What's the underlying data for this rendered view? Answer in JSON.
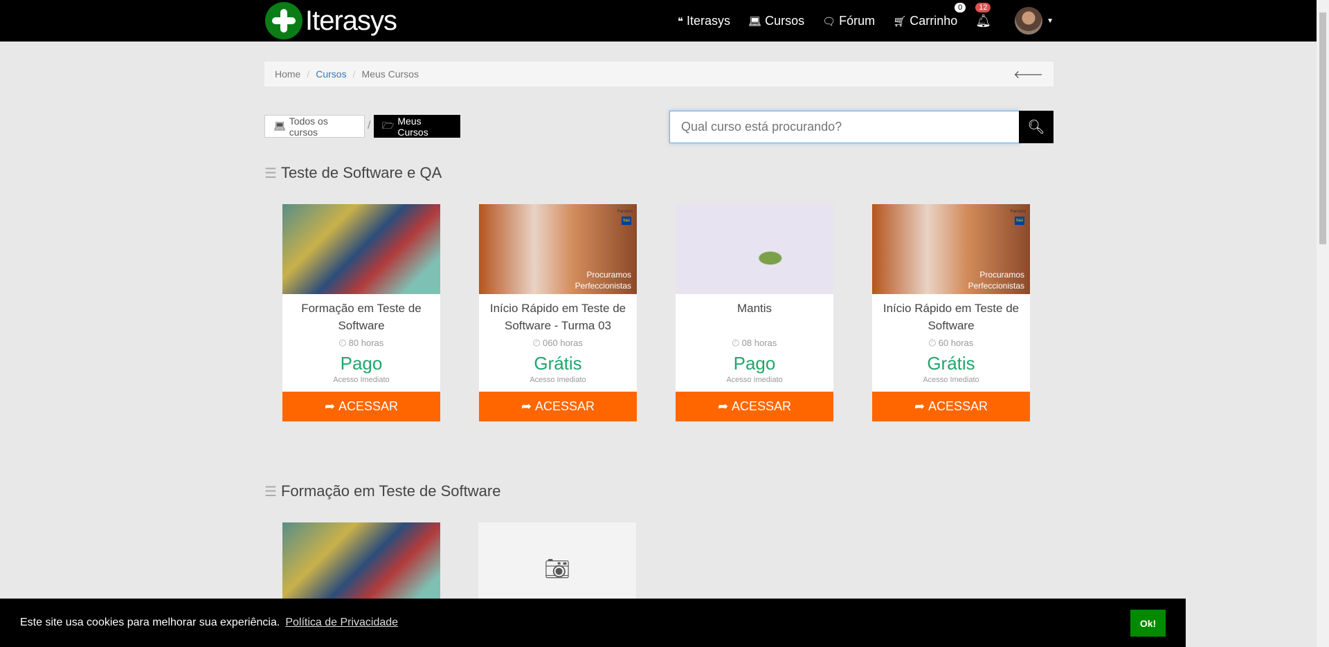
{
  "header": {
    "brand": "Iterasys",
    "nav": [
      {
        "label": "Iterasys",
        "icon": "quote-icon"
      },
      {
        "label": "Cursos",
        "icon": "laptop-icon"
      },
      {
        "label": "Fórum",
        "icon": "comments-icon"
      },
      {
        "label": "Carrinho",
        "icon": "cart-icon"
      }
    ],
    "cart_count": "0",
    "notifications": "12"
  },
  "breadcrumb": {
    "items": [
      "Home",
      "Cursos",
      "Meus Cursos"
    ]
  },
  "filters": {
    "all": "Todos os cursos",
    "sep": "/",
    "mine": "Meus Cursos"
  },
  "search": {
    "placeholder": "Qual curso está procurando?"
  },
  "sections": [
    {
      "title": "Teste de Software e QA",
      "cards": [
        {
          "title": "Formação em Teste de Software",
          "hours": "80 horas",
          "price": "Pago",
          "access": "Acesso Imediato",
          "button": "ACESSAR"
        },
        {
          "title": "Início Rápido em Teste de Software - Turma 03",
          "hours": "060 horas",
          "price": "Grátis",
          "access": "Acesso Imediato",
          "button": "ACESSAR",
          "overlay": "Procuramos Perfeccionistas",
          "partner": "Parceiro",
          "partner_logo": "Itaú"
        },
        {
          "title": "Mantis",
          "hours": "08 horas",
          "price": "Pago",
          "access": "Acesso Imediato",
          "button": "ACESSAR"
        },
        {
          "title": "Início Rápido em Teste de Software",
          "hours": "60 horas",
          "price": "Grátis",
          "access": "Acesso Imediato",
          "button": "ACESSAR",
          "overlay": "Procuramos Perfeccionistas",
          "partner": "Parceiro",
          "partner_logo": "Itaú"
        }
      ]
    },
    {
      "title": "Formação em Teste de Software"
    }
  ],
  "cookie": {
    "text": "Este site usa cookies para melhorar sua experiência.",
    "link": "Política de Privacidade",
    "ok": "Ok!"
  }
}
